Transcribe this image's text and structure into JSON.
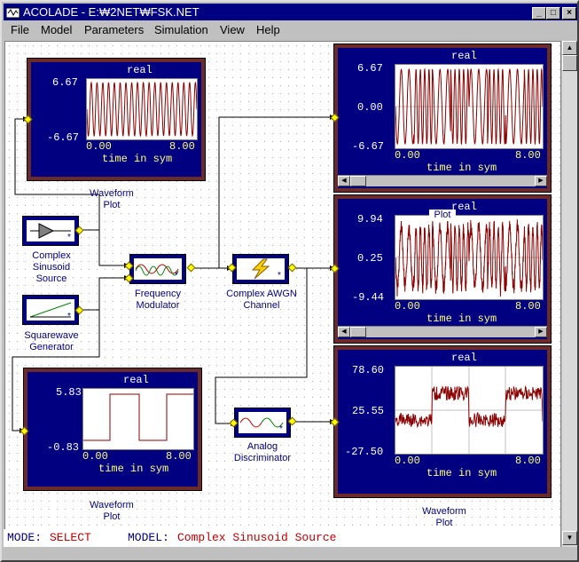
{
  "window": {
    "title": "ACOLADE - E:\\NET\\FSK.NET",
    "title_display": "ACOLADE - E:₩2NET₩FSK.NET"
  },
  "menu": [
    "File",
    "Model",
    "Parameters",
    "Simulation",
    "View",
    "Help"
  ],
  "status": {
    "mode_label": "MODE:",
    "mode_value": "SELECT",
    "model_label": "MODEL:",
    "model_value": "Complex Sinusoid Source"
  },
  "blocks": {
    "sinusoid": "Complex\nSinusoid\nSource",
    "squarewave": "Squarewave\nGenerator",
    "fm": "Frequency\nModulator",
    "awgn": "Complex AWGN\nChannel",
    "disc": "Analog\nDiscriminator",
    "wp1": "Waveform\nPlot",
    "wp2": "Waveform\nPlot",
    "wp3": "Waveform\nPlot",
    "wp_partial": "Plot"
  },
  "plots": {
    "p1": {
      "title": "real",
      "ymax": "6.67",
      "ymin": "-6.67",
      "x0": "0.00",
      "x1": "8.00",
      "xlabel": "time in sym"
    },
    "p2": {
      "title": "real",
      "ymax": "6.67",
      "ymid": "0.00",
      "ymin": "-6.67",
      "x0": "0.00",
      "x1": "8.00",
      "xlabel": "time in sym"
    },
    "p3": {
      "title": "real",
      "ymax": "9.94",
      "ymid": "0.25",
      "ymin": "-9.44",
      "x0": "0.00",
      "x1": "8.00",
      "xlabel": "time in sym"
    },
    "p4": {
      "title": "real",
      "ymax": "5.83",
      "ymin": "-0.83",
      "x0": "0.00",
      "x1": "8.00",
      "xlabel": "time in sym"
    },
    "p5": {
      "title": "real",
      "ymax": "78.60",
      "ymid": "25.55",
      "ymin": "-27.50",
      "x0": "0.00",
      "x1": "8.00",
      "xlabel": "time in sym"
    }
  },
  "colors": {
    "title_bg": "#000080",
    "plot_bg": "#000080",
    "plot_border": "#6b2b2b",
    "trace": "#8b0000",
    "port": "#ffff00",
    "status_text": "#c00000"
  }
}
